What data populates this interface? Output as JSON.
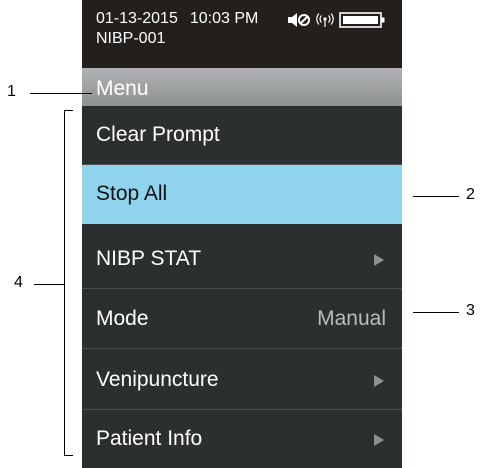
{
  "status_bar": {
    "date": "01-13-2015",
    "time": "10:03 PM",
    "device_id": "NIBP-001",
    "icons": [
      "speaker-muted-icon",
      "wireless-icon",
      "battery-icon"
    ]
  },
  "menu": {
    "title": "Menu",
    "items": [
      {
        "label": "Clear Prompt",
        "value": "",
        "arrow": false,
        "selected": false
      },
      {
        "label": "Stop All",
        "value": "",
        "arrow": false,
        "selected": true
      },
      {
        "label": "NIBP STAT",
        "value": "",
        "arrow": true,
        "selected": false
      },
      {
        "label": "Mode",
        "value": "Manual",
        "arrow": false,
        "selected": false
      },
      {
        "label": "Venipuncture",
        "value": "",
        "arrow": true,
        "selected": false
      },
      {
        "label": "Patient Info",
        "value": "",
        "arrow": true,
        "selected": false
      }
    ]
  },
  "callouts": {
    "c1": "1",
    "c2": "2",
    "c3": "3",
    "c4": "4"
  },
  "colors": {
    "screen_bg": "#2b2f30",
    "status_bg": "#231f1c",
    "selected_bg": "#8fd3ec",
    "header_bg": "#9fa2a3"
  }
}
